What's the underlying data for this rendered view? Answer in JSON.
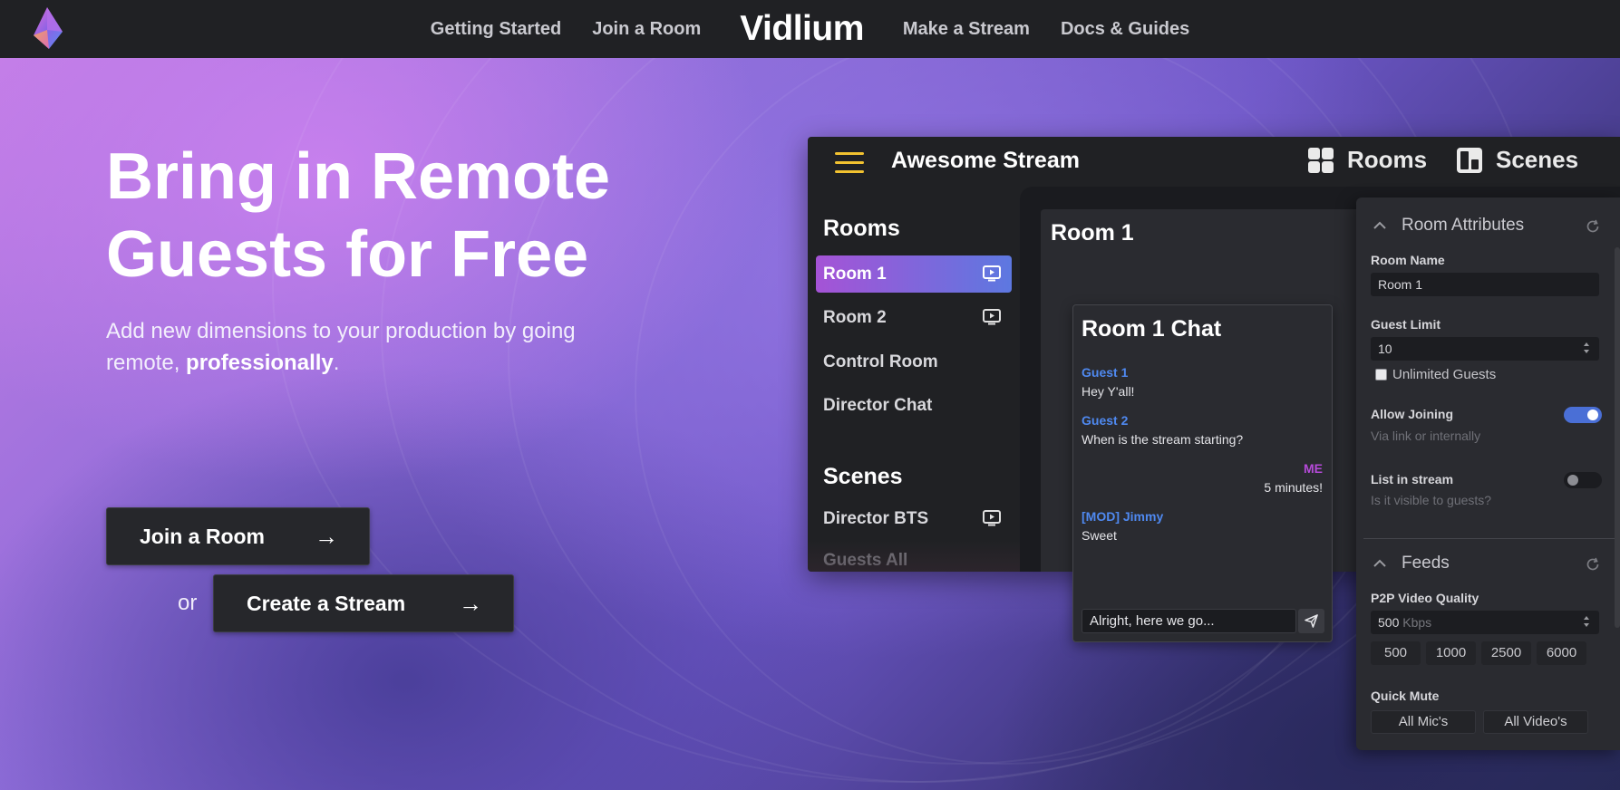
{
  "nav": {
    "links_left": [
      "Getting Started",
      "Join a Room"
    ],
    "brand": "Vidlium",
    "links_right": [
      "Make a Stream",
      "Docs & Guides"
    ]
  },
  "hero": {
    "title_line1": "Bring in Remote",
    "title_line2": "Guests for Free",
    "subtitle_prefix": "Add new dimensions to your production by going remote, ",
    "subtitle_bold": "professionally",
    "subtitle_suffix": ".",
    "join_button": "Join a Room",
    "or_text": "or",
    "create_button": "Create a Stream"
  },
  "app": {
    "title": "Awesome Stream",
    "header_rooms": "Rooms",
    "header_scenes": "Scenes",
    "sidebar": {
      "rooms_heading": "Rooms",
      "rooms": [
        {
          "label": "Room 1",
          "active": true,
          "tv": true
        },
        {
          "label": "Room 2",
          "active": false,
          "tv": true
        },
        {
          "label": "Control Room",
          "active": false,
          "tv": false
        },
        {
          "label": "Director Chat",
          "active": false,
          "tv": false
        }
      ],
      "scenes_heading": "Scenes",
      "scenes": [
        {
          "label": "Director BTS",
          "tv": true
        },
        {
          "label": "Guests All",
          "tv": false
        }
      ]
    },
    "room_card_title": "Room 1",
    "chat": {
      "title": "Room 1 Chat",
      "messages": [
        {
          "who": "Guest 1",
          "text": "Hey Y'all!"
        },
        {
          "who": "Guest 2",
          "text": "When is the stream starting?"
        },
        {
          "who": "ME",
          "text": "5 minutes!"
        },
        {
          "who": "[MOD] Jimmy",
          "text": "Sweet"
        }
      ],
      "input_value": "Alright, here we go..."
    },
    "settings": {
      "room_attributes_heading": "Room Attributes",
      "room_name_label": "Room Name",
      "room_name_value": "Room 1",
      "guest_limit_label": "Guest Limit",
      "guest_limit_value": "10",
      "unlimited_label": "Unlimited Guests",
      "allow_joining_label": "Allow Joining",
      "allow_joining_hint": "Via link or internally",
      "allow_joining_on": true,
      "list_in_stream_label": "List in stream",
      "list_in_stream_hint": "Is it visible to guests?",
      "list_in_stream_on": false,
      "feeds_heading": "Feeds",
      "p2p_label": "P2P Video Quality",
      "p2p_value": "500",
      "p2p_unit": "Kbps",
      "quality_options": [
        "500",
        "1000",
        "2500",
        "6000"
      ],
      "quick_mute_label": "Quick Mute",
      "all_mics": "All Mic's",
      "all_videos": "All Video's"
    }
  },
  "colors": {
    "accent_yellow": "#f2c230",
    "active_gradient_start": "#a553d6",
    "active_gradient_end": "#5d78e0",
    "chat_guest": "#4f89f0",
    "chat_me": "#b54ad9",
    "toggle_on": "#4a6fd6"
  }
}
